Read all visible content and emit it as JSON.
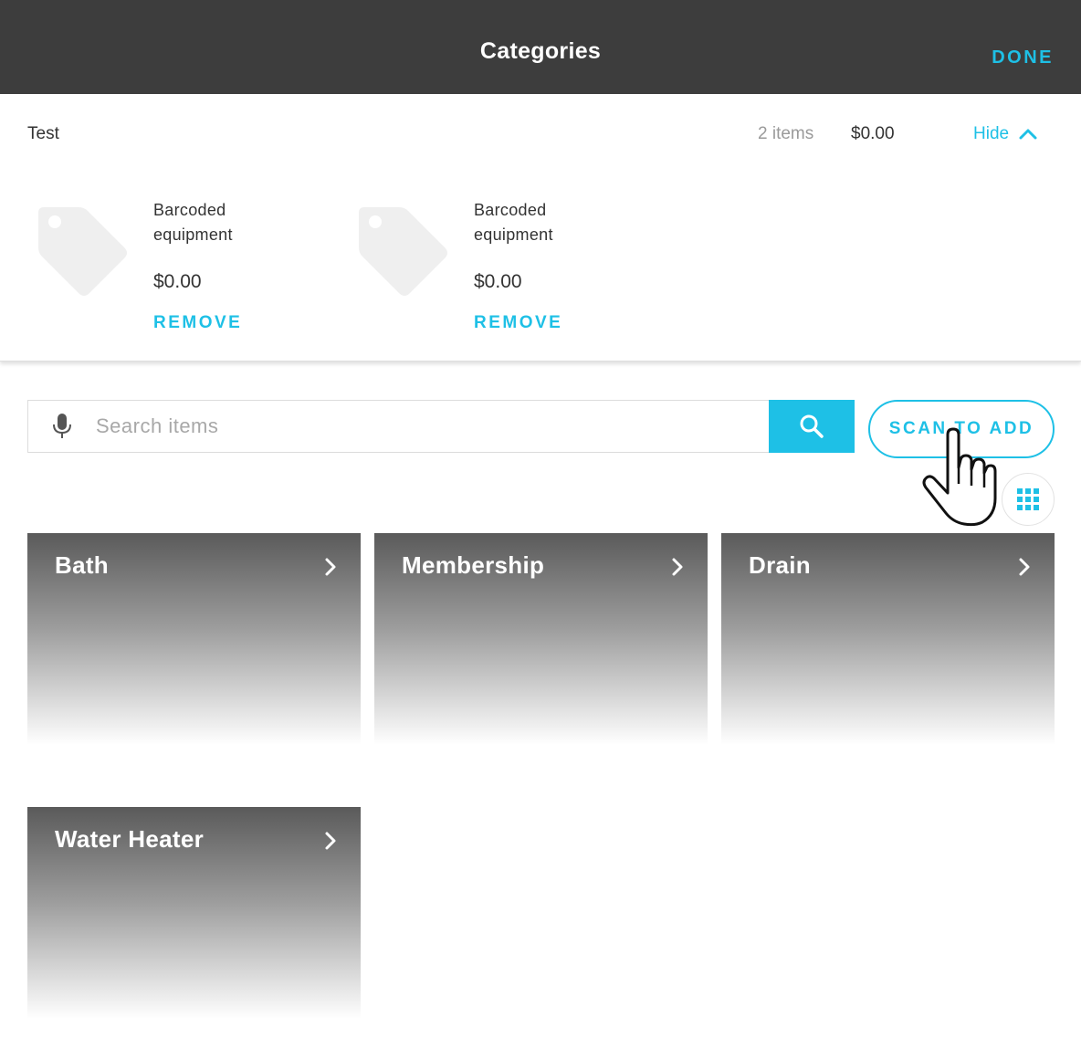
{
  "header": {
    "title": "Categories",
    "done_label": "DONE"
  },
  "cart": {
    "name": "Test",
    "count": "2 items",
    "total": "$0.00",
    "hide_label": "Hide",
    "items": [
      {
        "name": "Barcoded equipment",
        "price": "$0.00",
        "remove_label": "REMOVE",
        "icon": "price-tag-icon"
      },
      {
        "name": "Barcoded equipment",
        "price": "$0.00",
        "remove_label": "REMOVE",
        "icon": "price-tag-icon"
      }
    ]
  },
  "search": {
    "placeholder": "Search items",
    "value": ""
  },
  "scan": {
    "label": "SCAN TO ADD"
  },
  "categories": [
    {
      "label": "Bath"
    },
    {
      "label": "Membership"
    },
    {
      "label": "Drain"
    },
    {
      "label": "Water Heater"
    }
  ],
  "colors": {
    "accent": "#1ec0e6",
    "header_bg": "#3d3d3d",
    "tile_top": "#5a5a5a"
  },
  "icons": [
    "microphone-icon",
    "search-icon",
    "grid-icon",
    "chevron-up-icon",
    "chevron-right-icon",
    "hand-pointer-icon"
  ]
}
